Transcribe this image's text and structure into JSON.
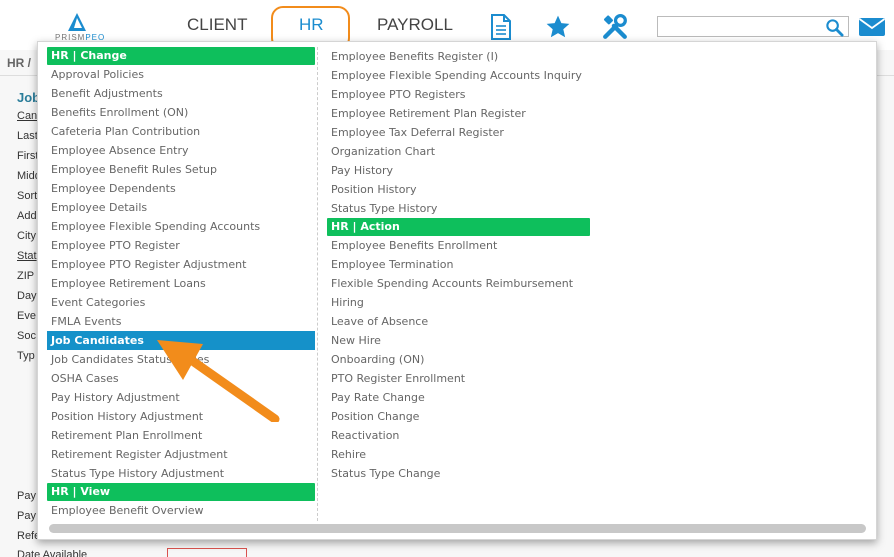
{
  "nav": {
    "logo": "PRISMPEO",
    "tabs": [
      {
        "label": "CLIENT"
      },
      {
        "label": "HR"
      },
      {
        "label": "PAYROLL"
      }
    ],
    "icons": [
      "document-icon",
      "star-icon",
      "tools-icon",
      "mail-icon"
    ],
    "search": {
      "placeholder": "",
      "value": ""
    }
  },
  "background_page": {
    "breadcrumb": "HR /",
    "title": "Job",
    "labels": [
      "Can",
      "Last",
      "First",
      "Midd",
      "Sort",
      "Add",
      "City",
      "Stat",
      "ZIP",
      "Day",
      "Eve",
      "Soc",
      "Typ",
      "Pay",
      "Pay",
      "Refe",
      "Date Available"
    ]
  },
  "menu": {
    "col1": [
      {
        "label": "HR | Change",
        "kind": "head"
      },
      {
        "label": "Approval Policies"
      },
      {
        "label": "Benefit Adjustments"
      },
      {
        "label": "Benefits Enrollment (ON)"
      },
      {
        "label": "Cafeteria Plan Contribution"
      },
      {
        "label": "Employee Absence Entry"
      },
      {
        "label": "Employee Benefit Rules Setup"
      },
      {
        "label": "Employee Dependents"
      },
      {
        "label": "Employee Details"
      },
      {
        "label": "Employee Flexible Spending Accounts"
      },
      {
        "label": "Employee PTO Register"
      },
      {
        "label": "Employee PTO Register Adjustment"
      },
      {
        "label": "Employee Retirement Loans"
      },
      {
        "label": "Event Categories"
      },
      {
        "label": "FMLA Events"
      },
      {
        "label": "Job Candidates",
        "kind": "active"
      },
      {
        "label": "Job Candidates Status Codes"
      },
      {
        "label": "OSHA Cases"
      },
      {
        "label": "Pay History Adjustment"
      },
      {
        "label": "Position History Adjustment"
      },
      {
        "label": "Retirement Plan Enrollment"
      },
      {
        "label": "Retirement Register Adjustment"
      },
      {
        "label": "Status Type History Adjustment"
      },
      {
        "label": "HR | View",
        "kind": "head"
      },
      {
        "label": "Employee Benefit Overview"
      }
    ],
    "col2": [
      {
        "label": "Employee Benefits Register (I)"
      },
      {
        "label": "Employee Flexible Spending Accounts Inquiry"
      },
      {
        "label": "Employee PTO Registers"
      },
      {
        "label": "Employee Retirement Plan Register"
      },
      {
        "label": "Employee Tax Deferral Register"
      },
      {
        "label": "Organization Chart"
      },
      {
        "label": "Pay History"
      },
      {
        "label": "Position History"
      },
      {
        "label": "Status Type History"
      },
      {
        "label": "HR | Action",
        "kind": "head"
      },
      {
        "label": "Employee Benefits Enrollment"
      },
      {
        "label": "Employee Termination"
      },
      {
        "label": "Flexible Spending Accounts Reimbursement"
      },
      {
        "label": "Hiring"
      },
      {
        "label": "Leave of Absence"
      },
      {
        "label": "New Hire"
      },
      {
        "label": "Onboarding (ON)"
      },
      {
        "label": "PTO Register Enrollment"
      },
      {
        "label": "Pay Rate Change"
      },
      {
        "label": "Position Change"
      },
      {
        "label": "Reactivation"
      },
      {
        "label": "Rehire"
      },
      {
        "label": "Status Type Change"
      }
    ]
  },
  "colors": {
    "accent": "#1b8ccf",
    "section_header": "#0ebf5c",
    "active_item": "#1591c9",
    "annotation": "#f28c1b"
  }
}
